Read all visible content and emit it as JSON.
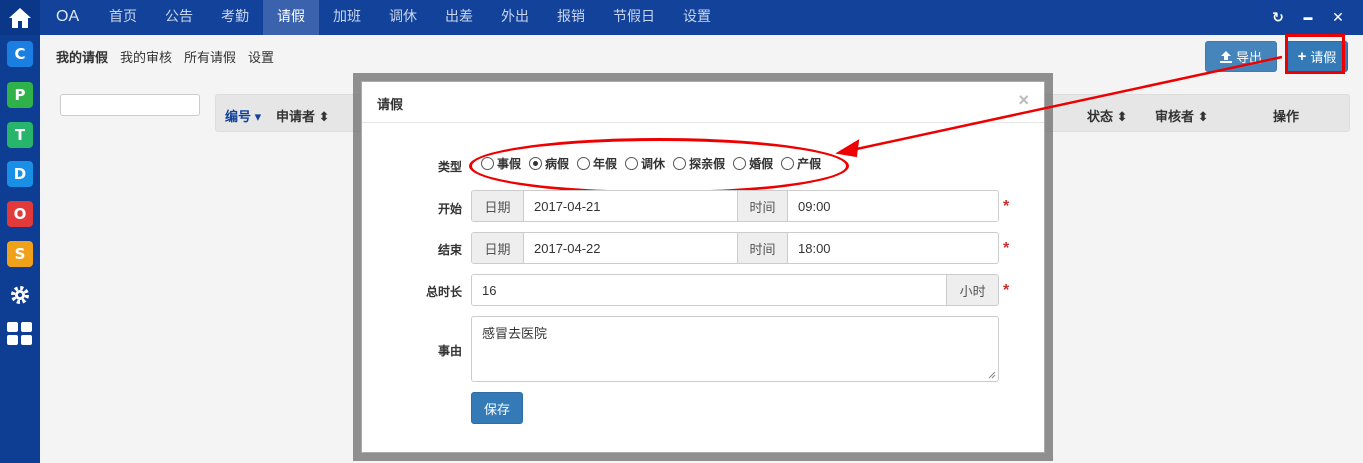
{
  "rail": {
    "apps": [
      {
        "letter": "C",
        "color": "#1a7fe0"
      },
      {
        "letter": "P",
        "color": "#2fb24a"
      },
      {
        "letter": "T",
        "color": "#27b46b"
      },
      {
        "letter": "D",
        "color": "#1a8fe6"
      },
      {
        "letter": "O",
        "color": "#e23a3a"
      },
      {
        "letter": "S",
        "color": "#f0a11a"
      }
    ]
  },
  "topnav": {
    "brand": "OA",
    "items": [
      "首页",
      "公告",
      "考勤",
      "请假",
      "加班",
      "调休",
      "出差",
      "外出",
      "报销",
      "节假日",
      "设置"
    ],
    "active_index": 3,
    "refresh_icon": "↻",
    "minimize_icon": "▬",
    "close_icon": "✕"
  },
  "subnav": {
    "items": [
      "我的请假",
      "我的审核",
      "所有请假",
      "设置"
    ],
    "active_index": 0
  },
  "toolbar": {
    "export_label": "导出",
    "add_label": "请假"
  },
  "table": {
    "columns": [
      {
        "label": "编号",
        "sort": "▾"
      },
      {
        "label": "申请者",
        "sort": "⬍"
      },
      {
        "label": "状态",
        "sort": "⬍"
      },
      {
        "label": "审核者",
        "sort": "⬍"
      },
      {
        "label": "操作",
        "sort": ""
      }
    ]
  },
  "modal": {
    "title": "请假",
    "close": "×",
    "type_label": "类型",
    "types": [
      "事假",
      "病假",
      "年假",
      "调休",
      "探亲假",
      "婚假",
      "产假"
    ],
    "selected_type": 1,
    "start_label": "开始",
    "end_label": "结束",
    "date_addon": "日期",
    "time_addon": "时间",
    "start_date": "2017-04-21",
    "start_time": "09:00",
    "end_date": "2017-04-22",
    "end_time": "18:00",
    "duration_label": "总时长",
    "duration_value": "16",
    "duration_unit": "小时",
    "reason_label": "事由",
    "reason_value": "感冒去医院",
    "save_label": "保存",
    "required_mark": "*"
  },
  "colors": {
    "nav_bg": "#12429a",
    "rail_bg": "#0d3e94",
    "primary": "#337ab7",
    "annotation": "#e00000"
  }
}
